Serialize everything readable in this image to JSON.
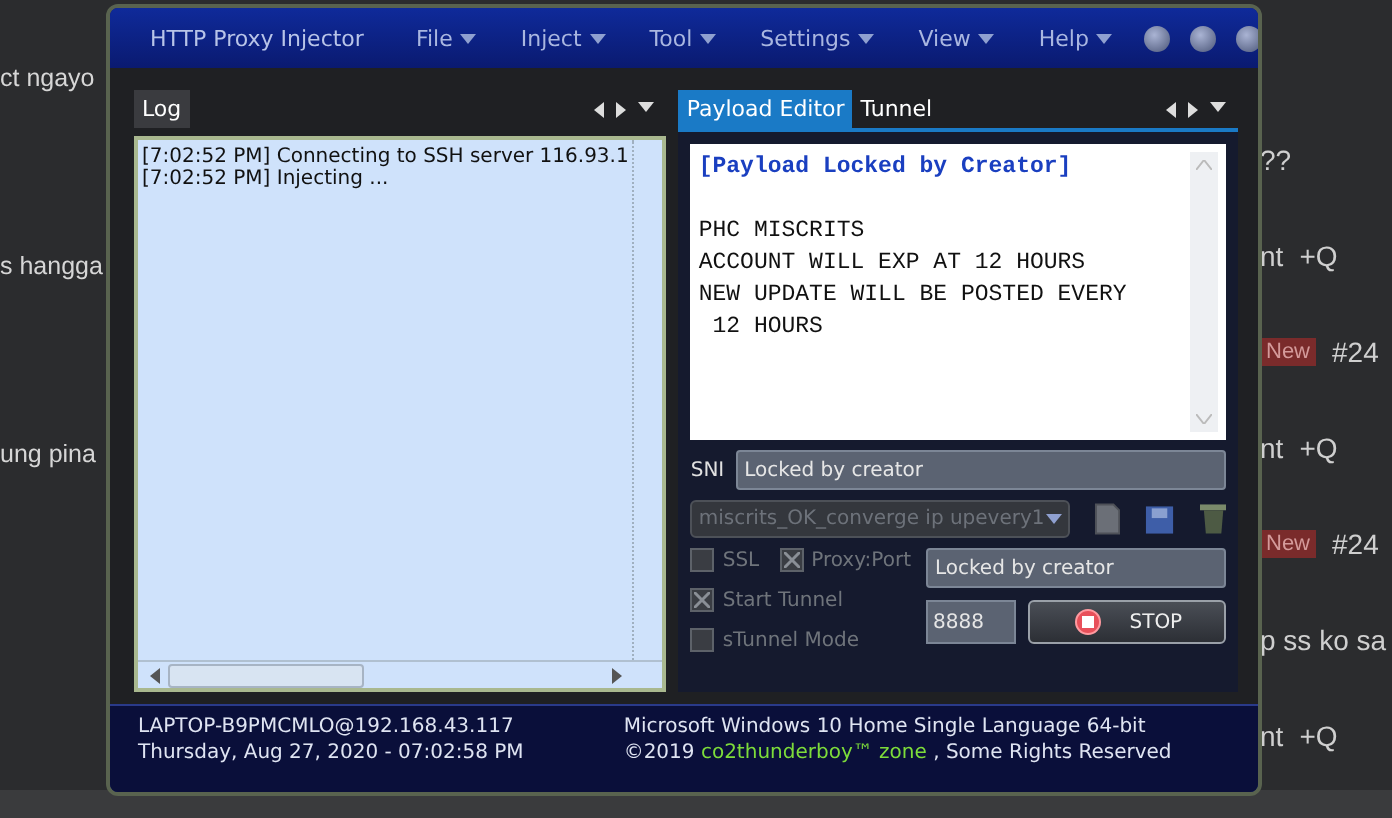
{
  "background": {
    "left_fragments": [
      "ct ngayo",
      "s hangga",
      "ung pina"
    ],
    "right_rows": [
      {
        "kind": "text",
        "text": "??"
      },
      {
        "kind": "actions",
        "text": "nt",
        "action": "+Q"
      },
      {
        "kind": "tag",
        "text": "New",
        "number": "#24"
      },
      {
        "kind": "actions",
        "text": "nt",
        "action": "+Q"
      },
      {
        "kind": "tag",
        "text": "New",
        "number": "#24"
      },
      {
        "kind": "text",
        "text": "p ss ko sa"
      },
      {
        "kind": "actions",
        "text": "nt",
        "action": "+Q"
      }
    ]
  },
  "window": {
    "title": "HTTP Proxy Injector",
    "menus": [
      "File",
      "Inject",
      "Tool",
      "Settings",
      "View",
      "Help"
    ]
  },
  "log_panel": {
    "tabs": [
      {
        "label": "Log",
        "selected": true
      }
    ],
    "lines": [
      "[7:02:52 PM] Connecting to SSH server 116.93.1",
      "[7:02:52 PM] Injecting ..."
    ]
  },
  "editor_panel": {
    "tabs": [
      {
        "label": "Payload Editor",
        "selected": true
      },
      {
        "label": "Tunnel",
        "selected": false
      }
    ],
    "notice": "[Payload Locked by Creator]",
    "lines": [
      "PHC MISCRITS",
      "ACCOUNT WILL EXP AT 12 HOURS",
      "NEW UPDATE WILL BE POSTED EVERY",
      " 12 HOURS"
    ]
  },
  "sni": {
    "label": "SNI",
    "value": "Locked by creator"
  },
  "config_select": {
    "value": "miscrits_OK_converge ip upevery1"
  },
  "checkboxes": [
    {
      "label": "SSL",
      "checked": false
    },
    {
      "label": "Proxy:Port",
      "checked": true
    },
    {
      "label": "Start Tunnel",
      "checked": true
    },
    {
      "label": "sTunnel Mode",
      "checked": false
    }
  ],
  "proxy": {
    "host": "Locked by creator",
    "port": "8888"
  },
  "stop_button": {
    "label": "STOP"
  },
  "status": {
    "host": "LAPTOP-B9PMCMLO@192.168.43.117",
    "datetime": "Thursday, Aug 27, 2020 - 07:02:58 PM",
    "os": "Microsoft Windows 10 Home Single Language 64-bit",
    "copyright_year": "©2019",
    "copyright_brand": "co2thunderboy™ zone",
    "copyright_rest": ", Some Rights Reserved"
  }
}
